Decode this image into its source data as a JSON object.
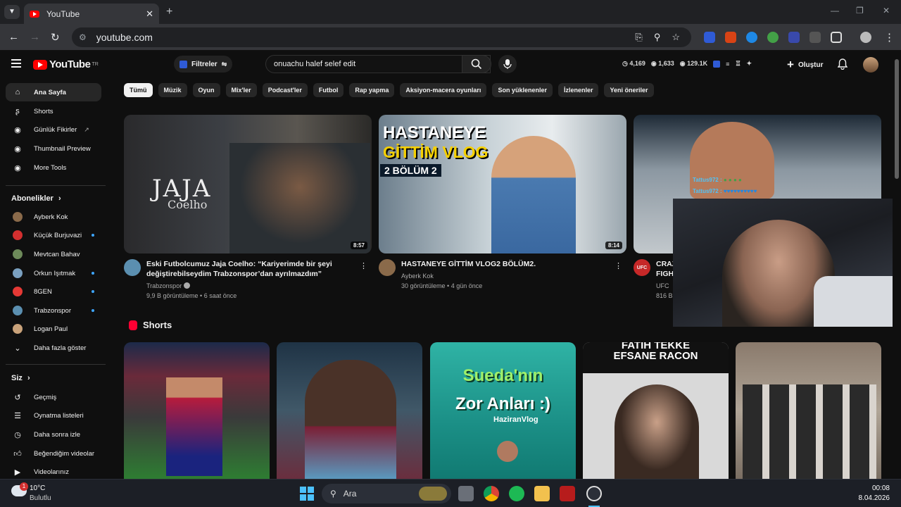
{
  "browser": {
    "tab_title": "YouTube",
    "new_tab": "+",
    "tab_close": "✕",
    "url": "youtube.com",
    "window_controls": [
      "—",
      "❐",
      "✕"
    ]
  },
  "header": {
    "logo_text": "YouTube",
    "logo_region": "TR",
    "filter_label": "Filtreler",
    "search_value": "onuachu halef selef edit",
    "stats": [
      "4,169",
      "1,633",
      "129.1K"
    ],
    "create_label": "Oluştur"
  },
  "sidebar": {
    "main": [
      {
        "label": "Ana Sayfa",
        "icon": "home-icon"
      },
      {
        "label": "Shorts",
        "icon": "shorts-icon"
      },
      {
        "label": "Günlük Fikirler",
        "icon": "extension-icon"
      },
      {
        "label": "Thumbnail Preview",
        "icon": "extension-icon"
      },
      {
        "label": "More Tools",
        "icon": "extension-icon"
      }
    ],
    "subs_title": "Abonelikler",
    "subs": [
      {
        "label": "Ayberk Kok",
        "color": "#8a6a4a",
        "dot": false
      },
      {
        "label": "Küçük Burjuvazi",
        "color": "#d32f2f",
        "dot": true
      },
      {
        "label": "Mevtcan Bahav",
        "color": "#6d8a5a",
        "dot": false
      },
      {
        "label": "Orkun Işıtmak",
        "color": "#7aa0c0",
        "dot": true
      },
      {
        "label": "8GEN",
        "color": "#e53935",
        "dot": true
      },
      {
        "label": "Trabzonspor",
        "color": "#5b8fb0",
        "dot": true
      },
      {
        "label": "Logan Paul",
        "color": "#c9a27a",
        "dot": false
      }
    ],
    "more_label": "Daha fazla göster",
    "you_title": "Siz",
    "you": [
      {
        "label": "Geçmiş",
        "icon": "history-icon"
      },
      {
        "label": "Oynatma listeleri",
        "icon": "playlist-icon"
      },
      {
        "label": "Daha sonra izle",
        "icon": "clock-icon"
      },
      {
        "label": "Beğendiğim videolar",
        "icon": "like-icon"
      },
      {
        "label": "Videolarınız",
        "icon": "video-icon"
      }
    ]
  },
  "chips": [
    "Tümü",
    "Müzik",
    "Oyun",
    "Mix'ler",
    "Podcast'ler",
    "Futbol",
    "Rap yapma",
    "Aksiyon-macera oyunları",
    "Son yüklenenler",
    "İzlenenler",
    "Yeni öneriler"
  ],
  "videos": [
    {
      "title": "Eski Futbolcumuz Jaja Coelho: “Kariyerimde bir şeyi değiştirebilseydim Trabzonspor’dan ayrılmazdım”",
      "channel": "Trabzonspor",
      "meta": "9,9 B görüntüleme • 6 saat önce",
      "duration": "8:57",
      "thumb_big": "JAJA",
      "thumb_small": "Coelho"
    },
    {
      "title": "HASTANEYE GİTTİM VLOG2 BÖLÜM2.",
      "channel": "Ayberk Kok",
      "meta": "30 görüntüleme • 4 gün önce",
      "duration": "8:14",
      "thumb_l1": "HASTANEYE",
      "thumb_l2": "GİTTİM VLOG",
      "thumb_l3": "2 BÖLÜM 2"
    },
    {
      "title": "CRAZ",
      "title2": "FIGH",
      "channel": "UFC",
      "meta": "816 B",
      "channel_badge": "UFC"
    }
  ],
  "overlay_chat": [
    "Tattus972 :",
    "Tattus972 :"
  ],
  "shorts": {
    "title": "Shorts",
    "items": [
      {
        "caption": ""
      },
      {
        "caption": ""
      },
      {
        "caption": "Sueda'nın",
        "caption2": "Zor Anları :)",
        "caption3": "HaziranVlog"
      },
      {
        "caption": "FATİH TEKKE",
        "caption2": "EFSANE RACON"
      },
      {
        "caption": ""
      }
    ]
  },
  "taskbar": {
    "temp": "10°C",
    "weather": "Bulutlu",
    "badge": "1",
    "search_placeholder": "Ara",
    "time": "00:08",
    "date": "8.04.2026"
  }
}
